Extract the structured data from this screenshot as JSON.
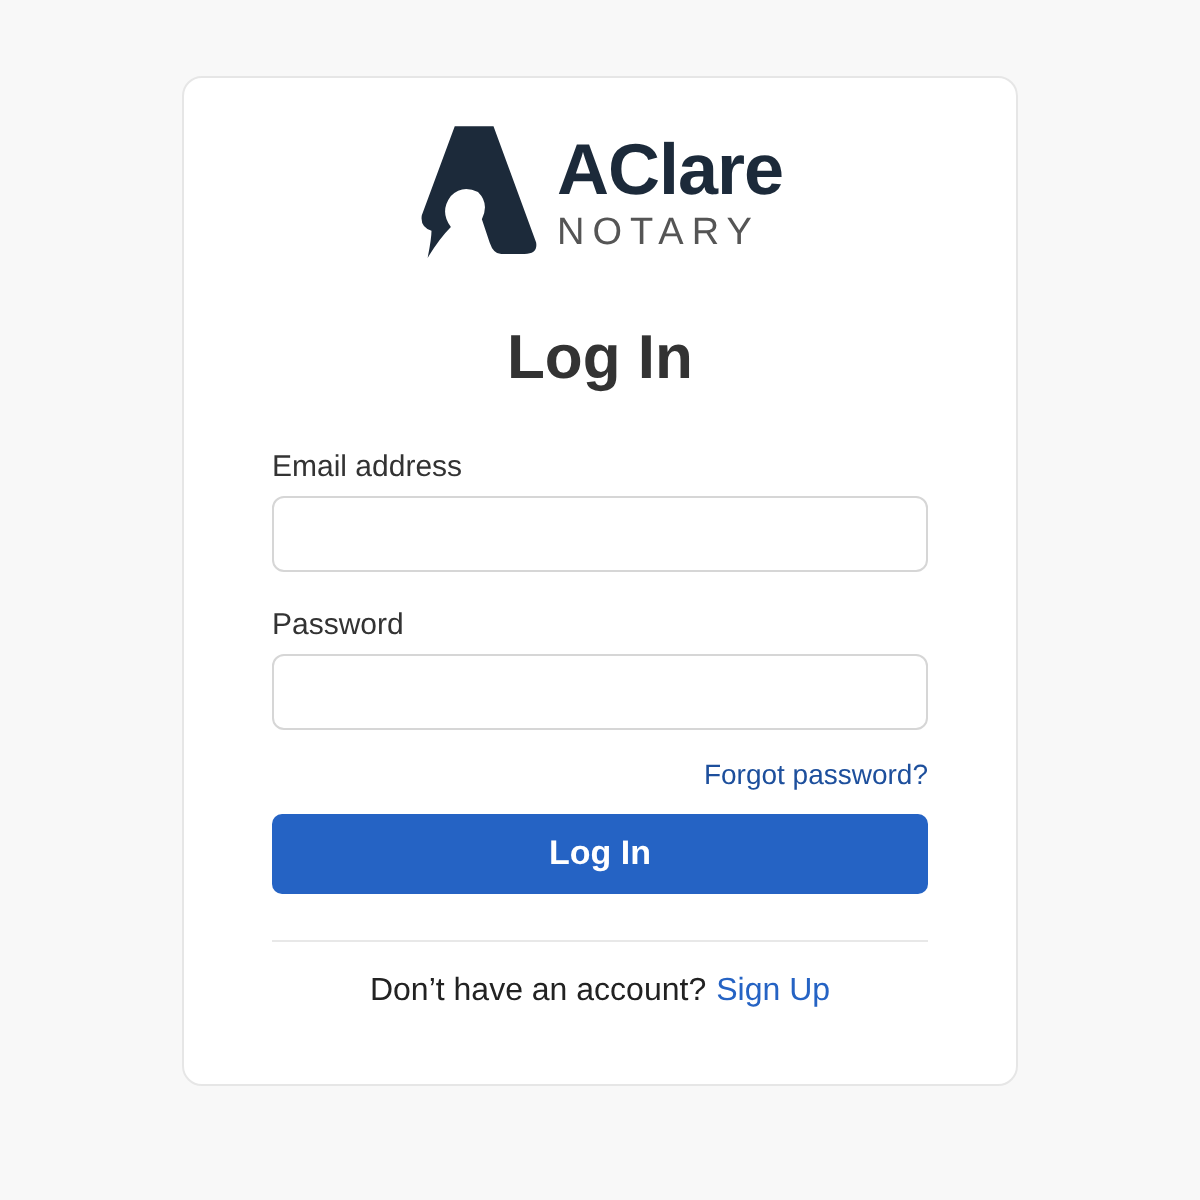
{
  "logo": {
    "name": "AClare",
    "subtitle": "NOTARY"
  },
  "title": "Log In",
  "fields": [
    {
      "label": "Email address"
    },
    {
      "label": "Password"
    }
  ],
  "forgot_link": "Forgot password?",
  "submit": "Log In",
  "signup": {
    "prompt": "Don’t have an account?",
    "link": "Sign Up"
  }
}
